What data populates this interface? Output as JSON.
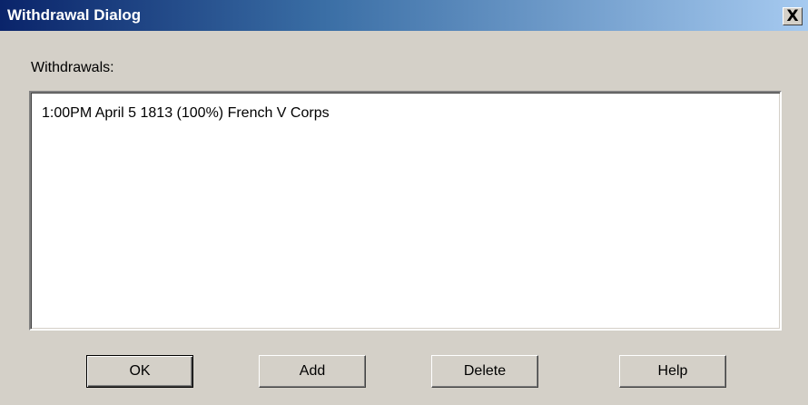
{
  "window": {
    "title": "Withdrawal Dialog",
    "close_glyph": "X",
    "close_icon": "close-icon"
  },
  "withdrawals": {
    "label": "Withdrawals:",
    "items": [
      "1:00PM April 5 1813 (100%) French V Corps"
    ]
  },
  "buttons": {
    "ok": "OK",
    "add": "Add",
    "delete": "Delete",
    "help": "Help"
  },
  "colors": {
    "face": "#d4d0c8",
    "title_start": "#0a246a",
    "title_end": "#a6caf0",
    "title_text": "#ffffff"
  }
}
